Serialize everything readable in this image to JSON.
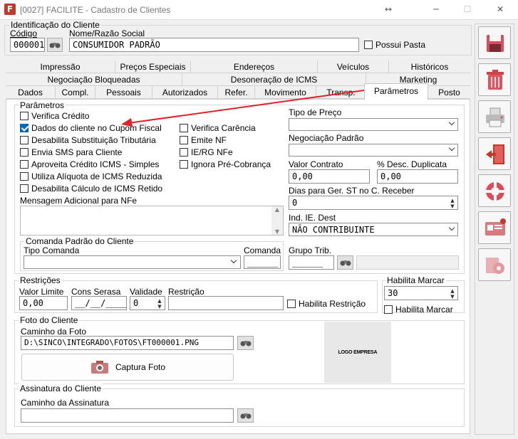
{
  "window": {
    "title": "[0027] FACILITE - Cadastro de Clientes"
  },
  "identificacao": {
    "group_label": "Identificação do Cliente",
    "codigo_label": "Código",
    "codigo_value": "000001",
    "nome_label": "Nome/Razão Social",
    "nome_value": "CONSUMIDOR PADRÃO",
    "possui_pasta_label": "Possui Pasta",
    "possui_pasta_checked": false
  },
  "tabs": {
    "row1": [
      "Impressão",
      "Preços Especiais",
      "Endereços",
      "Veículos",
      "Históricos"
    ],
    "row2": [
      "Negociação Bloqueadas",
      "Desoneração de ICMS",
      "Marketing"
    ],
    "row3": [
      "Dados",
      "Compl.",
      "Pessoais",
      "Autorizados",
      "Refer.",
      "Movimento",
      "Transp.",
      "Parâmetros",
      "Posto"
    ],
    "active": "Parâmetros"
  },
  "parametros": {
    "group_label": "Parâmetros",
    "checkboxes_left": [
      {
        "label": "Verifica Crédito",
        "checked": false
      },
      {
        "label": "Dados do cliente no Cupom Fiscal",
        "checked": true
      },
      {
        "label": "Desabilita Substituição Tributária",
        "checked": false
      },
      {
        "label": "Envia SMS para Cliente",
        "checked": false
      },
      {
        "label": "Aproveita Crédito ICMS - Simples",
        "checked": false
      },
      {
        "label": "Utiliza Alíquota de ICMS Reduzida",
        "checked": false
      },
      {
        "label": "Desabilita Cálculo de ICMS Retido",
        "checked": false
      }
    ],
    "checkboxes_right": [
      {
        "label": "Verifica Carência",
        "checked": false
      },
      {
        "label": "Emite NF",
        "checked": false
      },
      {
        "label": "IE/RG NFe",
        "checked": false
      },
      {
        "label": "Ignora Pré-Cobrança",
        "checked": false
      }
    ],
    "mensagem_label": "Mensagem Adicional para NFe",
    "tipo_preco_label": "Tipo de Preço",
    "tipo_preco_value": "",
    "negociacao_label": "Negociação Padrão",
    "negociacao_value": "",
    "valor_contrato_label": "Valor Contrato",
    "valor_contrato_value": "0,00",
    "desc_duplicata_label": "% Desc. Duplicata",
    "desc_duplicata_value": "0,00",
    "dias_label": "Dias para Ger. ST no C. Receber",
    "dias_value": "0",
    "ind_ie_label": "Ind. IE. Dest",
    "ind_ie_value": "NÃO CONTRIBUINTE",
    "comanda_group_label": "Comanda Padrão do Cliente",
    "tipo_comanda_label": "Tipo Comanda",
    "tipo_comanda_value": "",
    "comanda_label": "Comanda",
    "comanda_value": "______",
    "grupo_trib_label": "Grupo Trib.",
    "grupo_trib_value": "______"
  },
  "restricoes": {
    "group_label": "Restrições",
    "valor_limite_label": "Valor Limite",
    "valor_limite_value": "0,00",
    "cons_serasa_label": "Cons Serasa",
    "cons_serasa_value": "__/__/____",
    "validade_label": "Validade",
    "validade_value": "0",
    "restricao_label": "Restrição",
    "restricao_value": "",
    "habilita_restricao_label": "Habilita Restrição",
    "habilita_restricao_checked": false
  },
  "habilita_marcar": {
    "group_label": "Habilita Marcar",
    "value": "30",
    "checkbox_label": "Habilita Marcar",
    "checked": false
  },
  "foto": {
    "group_label": "Foto do Cliente",
    "caminho_label": "Caminho da Foto",
    "caminho_value": "D:\\SINCO\\INTEGRADO\\FOTOS\\FT000001.PNG",
    "captura_label": "Captura Foto",
    "logo_text": "LOGO EMPRESA"
  },
  "assinatura": {
    "group_label": "Assinatura do Cliente",
    "caminho_label": "Caminho da Assinatura",
    "caminho_value": ""
  },
  "sidebar": {
    "buttons": [
      "save-icon",
      "trash-icon",
      "printer-icon",
      "exit-door-icon",
      "help-lifebuoy-icon",
      "id-card-icon",
      "settings-gear-icon"
    ]
  },
  "colors": {
    "accent_check": "#0067c0",
    "arrow_annotation": "#e0202a"
  }
}
